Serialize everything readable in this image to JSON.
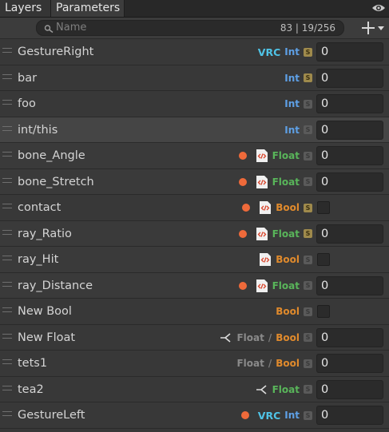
{
  "tabs": [
    {
      "label": "Layers"
    },
    {
      "label": "Parameters"
    }
  ],
  "icons": {
    "visibility": "eye-icon",
    "add": "plus-icon",
    "search": "search-icon",
    "script": "script-icon",
    "branch": "branch-icon"
  },
  "search": {
    "placeholder": "Name",
    "count": "83 | 19/256"
  },
  "colors": {
    "vrc": "#4fc3e6",
    "int": "#5ea0e6",
    "float": "#59b55a",
    "bool": "#e08a2c",
    "dot": "#ef6a3a"
  },
  "params": [
    {
      "name": "GestureRight",
      "vrc": "VRC",
      "type": "Int",
      "saved": "S",
      "value": "0"
    },
    {
      "name": "bar",
      "type": "Int",
      "saved": "S",
      "value": "0"
    },
    {
      "name": "foo",
      "type": "Int",
      "value": "0"
    },
    {
      "name": "int/this",
      "type": "Int",
      "value": "0"
    },
    {
      "name": "bone_Angle",
      "type": "Float",
      "value": "0"
    },
    {
      "name": "bone_Stretch",
      "type": "Float",
      "value": "0"
    },
    {
      "name": "contact",
      "type": "Bool",
      "saved": "S"
    },
    {
      "name": "ray_Ratio",
      "type": "Float",
      "saved": "S",
      "value": "0"
    },
    {
      "name": "ray_Hit",
      "type": "Bool"
    },
    {
      "name": "ray_Distance",
      "type": "Float",
      "value": "0"
    },
    {
      "name": "New Bool",
      "type": "Bool"
    },
    {
      "name": "New Float",
      "type1": "Float",
      "sep": "/",
      "type2": "Bool",
      "value": "0"
    },
    {
      "name": "tets1",
      "type1": "Float",
      "sep": "/",
      "type2": "Bool",
      "value": "0"
    },
    {
      "name": "tea2",
      "type": "Float",
      "value": "0"
    },
    {
      "name": "GestureLeft",
      "vrc": "VRC",
      "type": "Int",
      "value": "0"
    }
  ]
}
